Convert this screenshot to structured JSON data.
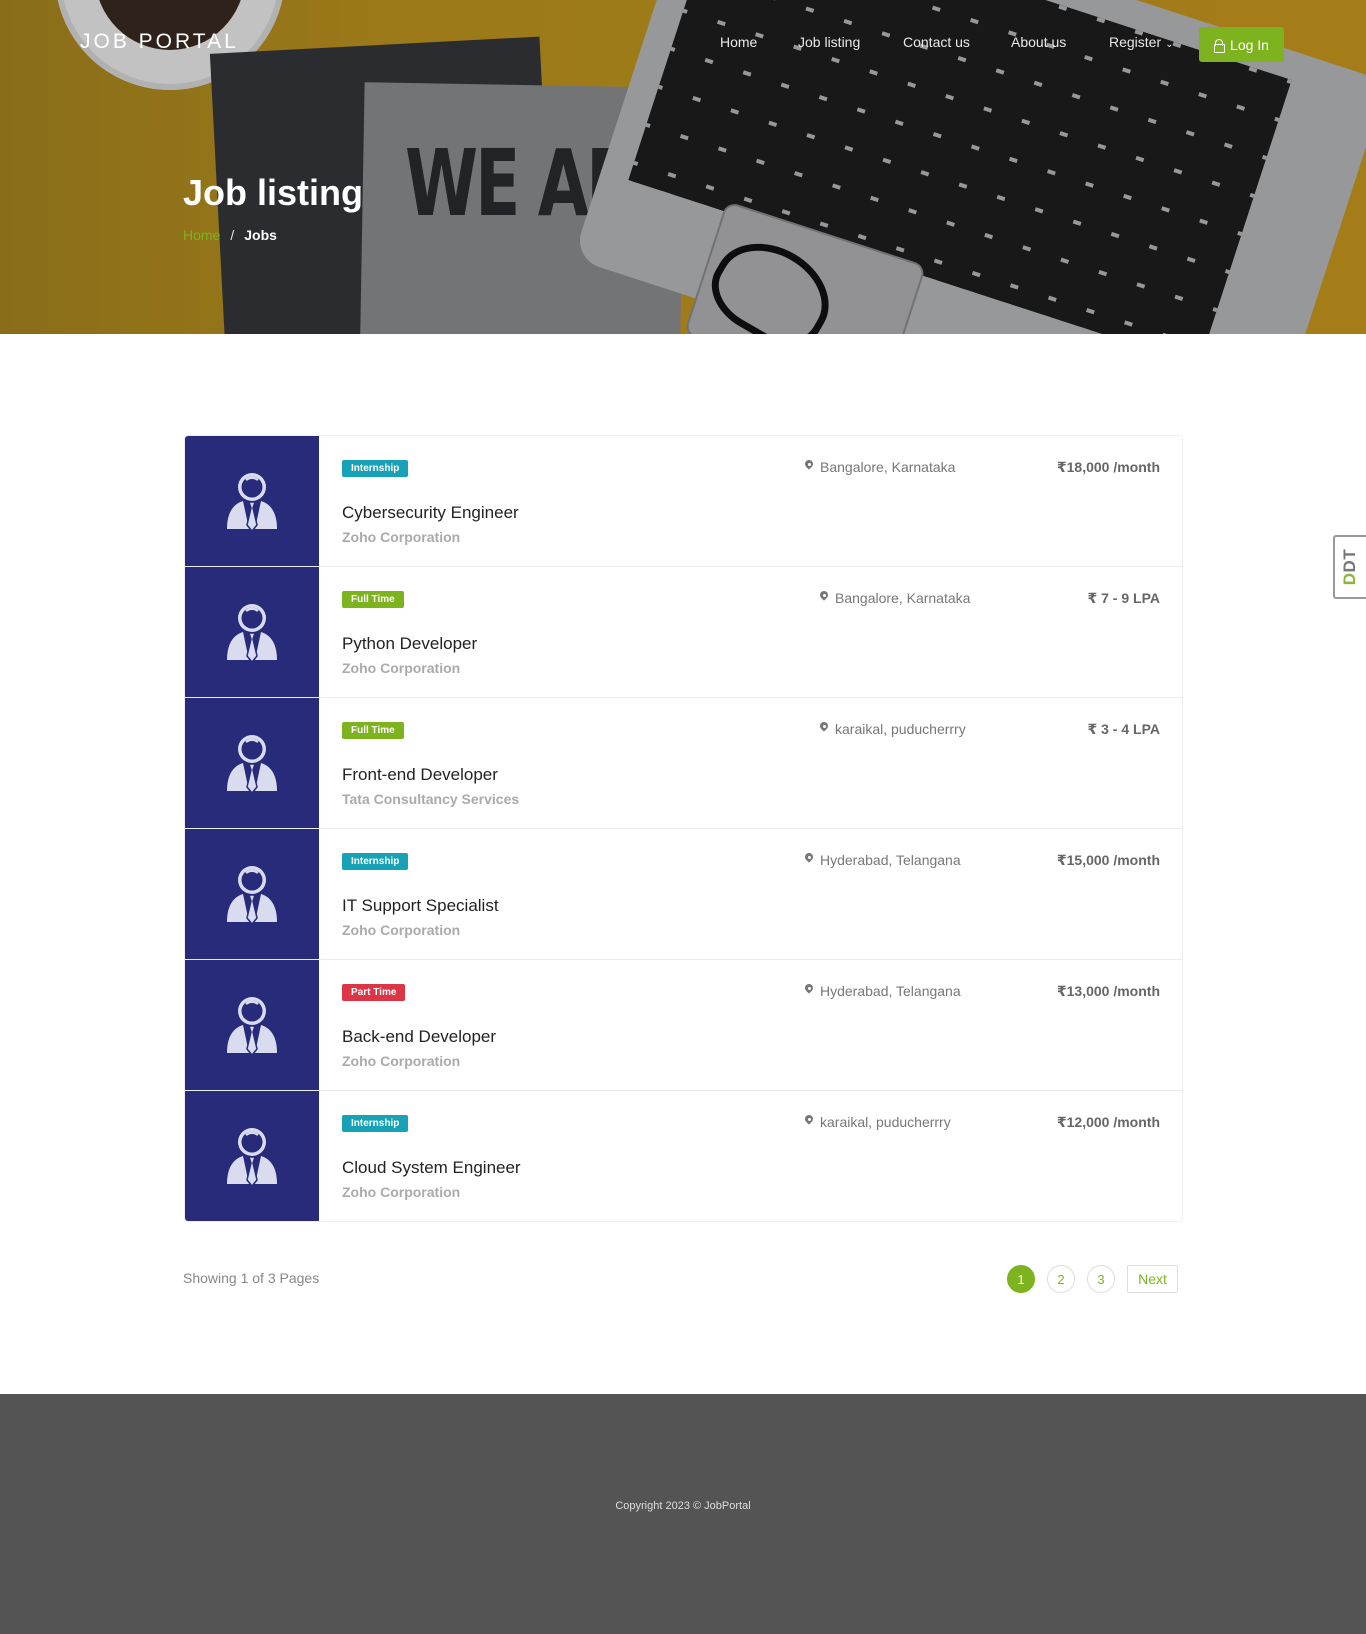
{
  "header": {
    "brand": "JOB PORTAL",
    "nav": [
      {
        "label": "Home"
      },
      {
        "label": "Job listing"
      },
      {
        "label": "Contact us"
      },
      {
        "label": "About us"
      },
      {
        "label": "Register"
      }
    ],
    "login_label": "Log In"
  },
  "hero": {
    "title": "Job listing",
    "image_text": "WE ARE",
    "breadcrumb": {
      "home": "Home",
      "separator": "/",
      "current": "Jobs"
    }
  },
  "side_tab": {
    "prefix": "D",
    "suffix": "DT"
  },
  "jobs": [
    {
      "type": "Internship",
      "title": "Cybersecurity Engineer",
      "company": "Zoho Corporation",
      "location": "Bangalore, Karnataka",
      "salary": "₹18,000 /month"
    },
    {
      "type": "Full Time",
      "title": "Python Developer",
      "company": "Zoho Corporation",
      "location": "Bangalore, Karnataka",
      "salary": "₹ 7 - 9 LPA"
    },
    {
      "type": "Full Time",
      "title": "Front-end Developer",
      "company": "Tata Consultancy Services",
      "location": "karaikal, puducherrry",
      "salary": "₹ 3 - 4 LPA"
    },
    {
      "type": "Internship",
      "title": "IT Support Specialist",
      "company": "Zoho Corporation",
      "location": "Hyderabad, Telangana",
      "salary": "₹15,000 /month"
    },
    {
      "type": "Part Time",
      "title": "Back-end Developer",
      "company": "Zoho Corporation",
      "location": "Hyderabad, Telangana",
      "salary": "₹13,000 /month"
    },
    {
      "type": "Internship",
      "title": "Cloud System Engineer",
      "company": "Zoho Corporation",
      "location": "karaikal, puducherrry",
      "salary": "₹12,000 /month"
    }
  ],
  "pagination": {
    "showing": "Showing 1 of 3 Pages",
    "pages": [
      "1",
      "2",
      "3"
    ],
    "active_page": "1",
    "next_label": "Next"
  },
  "footer": {
    "copyright": "Copyright 2023 © JobPortal"
  },
  "colors": {
    "accent": "#7cb31e",
    "thumb_bg": "#272b79",
    "internship": "#17a2b8",
    "full_time": "#7cb31e",
    "part_time": "#dc3545",
    "footer_bg": "#545454"
  }
}
